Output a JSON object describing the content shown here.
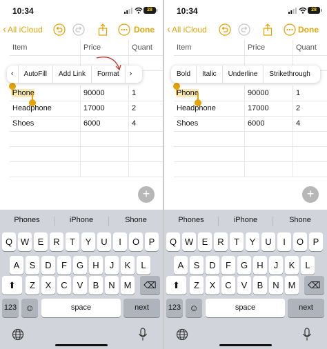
{
  "status": {
    "time": "10:34",
    "battery": "28"
  },
  "nav": {
    "back_label": "All iCloud",
    "done_label": "Done",
    "accent_color": "#e5a50a"
  },
  "table": {
    "headers": [
      "Item",
      "Price",
      "Quant"
    ],
    "rows": [
      [
        "Phone",
        "90000",
        "1"
      ],
      [
        "Headphone",
        "17000",
        "2"
      ],
      [
        "Shoes",
        "6000",
        "4"
      ]
    ]
  },
  "left_menu": {
    "prev_arrow": "‹",
    "items": [
      "AutoFill",
      "Add Link",
      "Format"
    ],
    "next_arrow": "›"
  },
  "right_menu": {
    "items": [
      "Bold",
      "Italic",
      "Underline",
      "Strikethrough"
    ]
  },
  "fab_label": "+",
  "predictions": [
    "Phones",
    "iPhone",
    "Shone"
  ],
  "keyboard": {
    "row1": [
      "Q",
      "W",
      "E",
      "R",
      "T",
      "Y",
      "U",
      "I",
      "O",
      "P"
    ],
    "row2": [
      "A",
      "S",
      "D",
      "F",
      "G",
      "H",
      "J",
      "K",
      "L"
    ],
    "row3": [
      "Z",
      "X",
      "C",
      "V",
      "B",
      "N",
      "M"
    ],
    "numbers_label": "123",
    "emoji_label": "☺",
    "space_label": "space",
    "next_label": "next",
    "shift_label": "⬆",
    "delete_label": "⌫"
  },
  "icons": [
    "undo-icon",
    "redo-icon",
    "share-icon",
    "more-icon",
    "globe-icon",
    "microphone-icon",
    "signal-icon",
    "wifi-icon",
    "battery-icon"
  ],
  "annotation_color": "#c0392b"
}
